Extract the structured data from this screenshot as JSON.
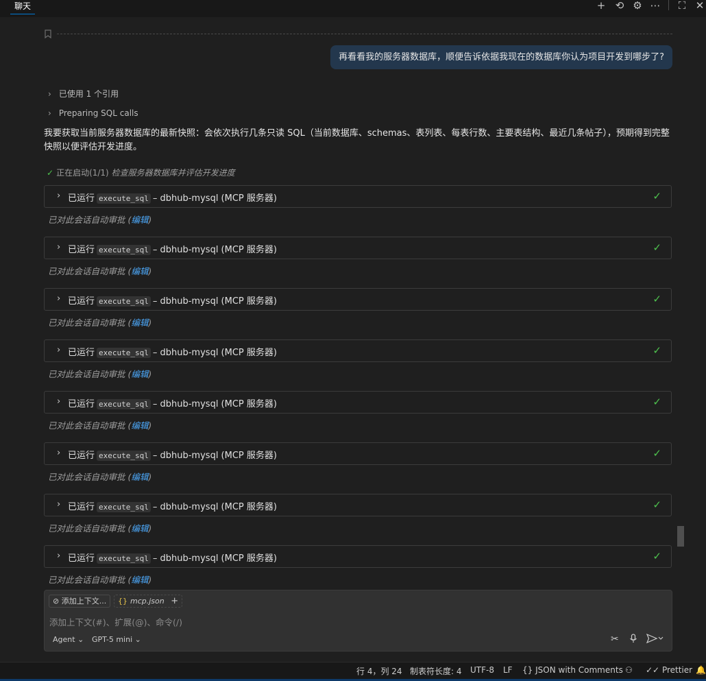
{
  "tab": {
    "title": "聊天"
  },
  "toolbar": {
    "new_chat": "+",
    "history": "⟲",
    "settings": "⚙",
    "more": "⋯",
    "maximize": "⛶",
    "close": "✕"
  },
  "user_message": "再看看我的服务器数据库，顺便告诉依据我现在的数据库你认为项目开发到哪步了?",
  "references": "已使用 1 个引用",
  "preparing": "Preparing SQL calls",
  "summary": "我要获取当前服务器数据库的最新快照：会依次执行几条只读 SQL（当前数据库、schemas、表列表、每表行数、主要表结构、最近几条帖子），预期得到完整快照以便评估开发进度。",
  "progress": {
    "status": "正在启动(1/1)",
    "task": "检查服务器数据库并评估开发进度"
  },
  "tool_calls": [
    {
      "prefix": "已运行",
      "tool": "execute_sql",
      "suffix": "– dbhub-mysql (MCP 服务器)"
    },
    {
      "prefix": "已运行",
      "tool": "execute_sql",
      "suffix": "– dbhub-mysql (MCP 服务器)"
    },
    {
      "prefix": "已运行",
      "tool": "execute_sql",
      "suffix": "– dbhub-mysql (MCP 服务器)"
    },
    {
      "prefix": "已运行",
      "tool": "execute_sql",
      "suffix": "– dbhub-mysql (MCP 服务器)"
    },
    {
      "prefix": "已运行",
      "tool": "execute_sql",
      "suffix": "– dbhub-mysql (MCP 服务器)"
    },
    {
      "prefix": "已运行",
      "tool": "execute_sql",
      "suffix": "– dbhub-mysql (MCP 服务器)"
    },
    {
      "prefix": "已运行",
      "tool": "execute_sql",
      "suffix": "– dbhub-mysql (MCP 服务器)"
    },
    {
      "prefix": "已运行",
      "tool": "execute_sql",
      "suffix": "– dbhub-mysql (MCP 服务器)"
    }
  ],
  "approval": {
    "text": "已对此会话自动审批 (",
    "link": "编辑",
    "close": ")"
  },
  "input": {
    "add_context": "添加上下文...",
    "file_chip": "mcp.json",
    "placeholder": "添加上下文(#)、扩展(@)、命令(/)",
    "mode": "Agent",
    "model": "GPT-5 mini"
  },
  "status_bar": {
    "position": "行 4，列 24",
    "tab_size": "制表符长度: 4",
    "encoding": "UTF-8",
    "eol": "LF",
    "language": "JSON with Comments",
    "formatter": "Prettier"
  },
  "colors": {
    "accent": "#0078d4",
    "success": "#4ec24e",
    "link": "#4daafc",
    "user_bubble": "#23374d"
  }
}
